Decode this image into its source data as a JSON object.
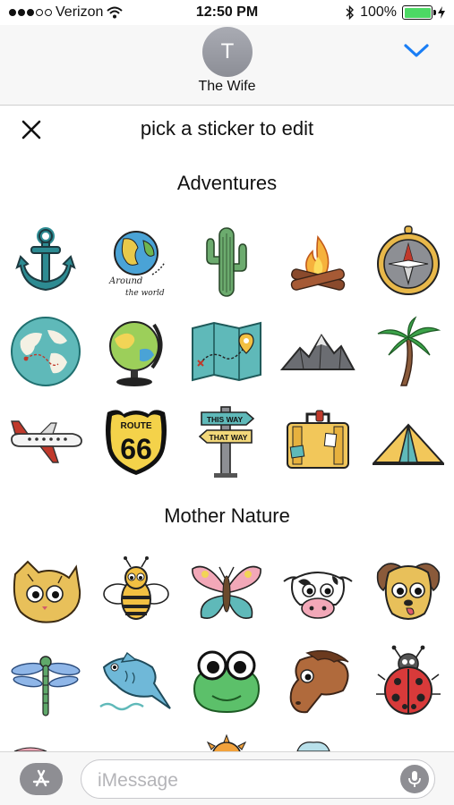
{
  "status": {
    "carrier": "Verizon",
    "time": "12:50 PM",
    "battery": "100%"
  },
  "header": {
    "avatar_initial": "T",
    "contact_name": "The Wife"
  },
  "drawer": {
    "title": "pick a sticker to edit"
  },
  "sections": [
    {
      "title": "Adventures",
      "stickers": [
        {
          "name": "anchor-sticker",
          "icon": "anchor"
        },
        {
          "name": "around-the-world-sticker",
          "icon": "globe-lettering",
          "text_top": "Around",
          "text_bottom": "the world"
        },
        {
          "name": "cactus-sticker",
          "icon": "cactus"
        },
        {
          "name": "campfire-sticker",
          "icon": "campfire"
        },
        {
          "name": "compass-sticker",
          "icon": "compass"
        },
        {
          "name": "world-map-globe-sticker",
          "icon": "world-globe"
        },
        {
          "name": "desk-globe-sticker",
          "icon": "desk-globe"
        },
        {
          "name": "folded-map-sticker",
          "icon": "folded-map"
        },
        {
          "name": "mountains-sticker",
          "icon": "mountains"
        },
        {
          "name": "palm-tree-sticker",
          "icon": "palm-tree"
        },
        {
          "name": "airplane-sticker",
          "icon": "airplane"
        },
        {
          "name": "route-66-sticker",
          "icon": "route-66",
          "text_top": "ROUTE",
          "text_main": "66"
        },
        {
          "name": "signpost-sticker",
          "icon": "signpost",
          "text_top": "THIS WAY",
          "text_bottom": "THAT WAY"
        },
        {
          "name": "suitcase-sticker",
          "icon": "suitcase"
        },
        {
          "name": "tent-sticker",
          "icon": "tent"
        }
      ]
    },
    {
      "title": "Mother Nature",
      "stickers": [
        {
          "name": "cat-sticker",
          "icon": "cat"
        },
        {
          "name": "bee-sticker",
          "icon": "bee"
        },
        {
          "name": "butterfly-sticker",
          "icon": "butterfly"
        },
        {
          "name": "cow-sticker",
          "icon": "cow"
        },
        {
          "name": "dog-sticker",
          "icon": "dog"
        },
        {
          "name": "dragonfly-sticker",
          "icon": "dragonfly"
        },
        {
          "name": "fish-sticker",
          "icon": "fish"
        },
        {
          "name": "frog-sticker",
          "icon": "frog"
        },
        {
          "name": "horse-sticker",
          "icon": "horse"
        },
        {
          "name": "ladybug-sticker",
          "icon": "ladybug"
        }
      ]
    }
  ],
  "input": {
    "placeholder": "iMessage"
  },
  "colors": {
    "accent": "#1a7ef5",
    "battery": "#4cd964",
    "bar": "#f7f7f7",
    "teal": "#2d8b92"
  }
}
